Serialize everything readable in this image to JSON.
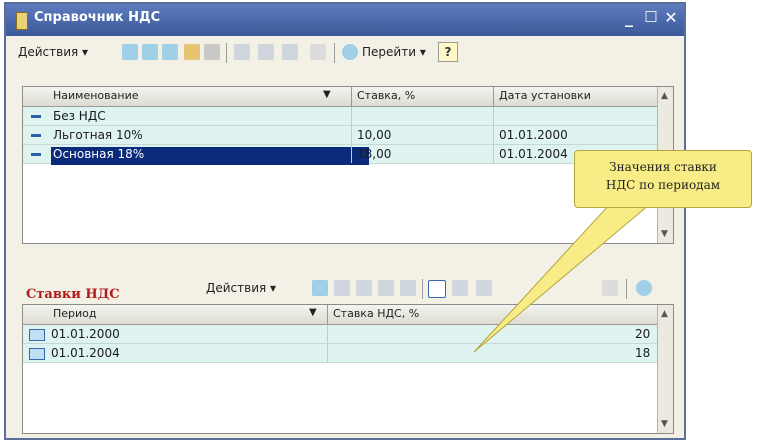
{
  "window": {
    "title": "Справочник НДС"
  },
  "toolbar": {
    "actions_label": "Действия",
    "goto_label": "Перейти",
    "help_label": "?"
  },
  "main_table": {
    "headers": [
      "Наименование",
      "Ставка, %",
      "Дата установки"
    ],
    "rows": [
      {
        "name": "Без НДС",
        "rate": "",
        "date": ""
      },
      {
        "name": "Льготная 10%",
        "rate": "10,00",
        "date": "01.01.2000"
      },
      {
        "name": "Основная 18%",
        "rate": "18,00",
        "date": "01.01.2004"
      }
    ]
  },
  "rates_section": {
    "title": "Ставки НДС",
    "actions_label": "Действия",
    "headers": [
      "Период",
      "Ставка НДС, %"
    ],
    "rows": [
      {
        "period": "01.01.2000",
        "rate": "20"
      },
      {
        "period": "01.01.2004",
        "rate": "18"
      }
    ]
  },
  "callout": {
    "line1": "Значения ставки",
    "line2": "НДС по периодам"
  },
  "colors": {
    "title_bar": "#3b5a9a",
    "row_bg": "#dff3f1",
    "selected_row": "#0a2a7c",
    "section_title": "#b21a1a",
    "callout_bg": "#f7ec86"
  }
}
